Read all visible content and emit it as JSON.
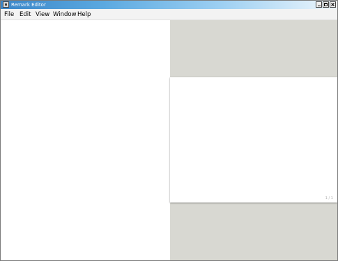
{
  "window": {
    "title": "Remark Editor"
  },
  "menubar": {
    "items": [
      "File",
      "Edit",
      "View",
      "Window",
      "Help"
    ]
  },
  "preview": {
    "slide_number": "1 / 1"
  },
  "colors": {
    "titlebar_start": "#3b86c8",
    "titlebar_end": "#eef6fc",
    "menubar_bg": "#f3f3f3",
    "preview_bg": "#d8d8d2",
    "slide_bg": "#ffffff"
  },
  "icons": {
    "app": "app-icon",
    "minimize": "minimize-icon",
    "maximize": "maximize-icon",
    "close": "close-icon"
  }
}
